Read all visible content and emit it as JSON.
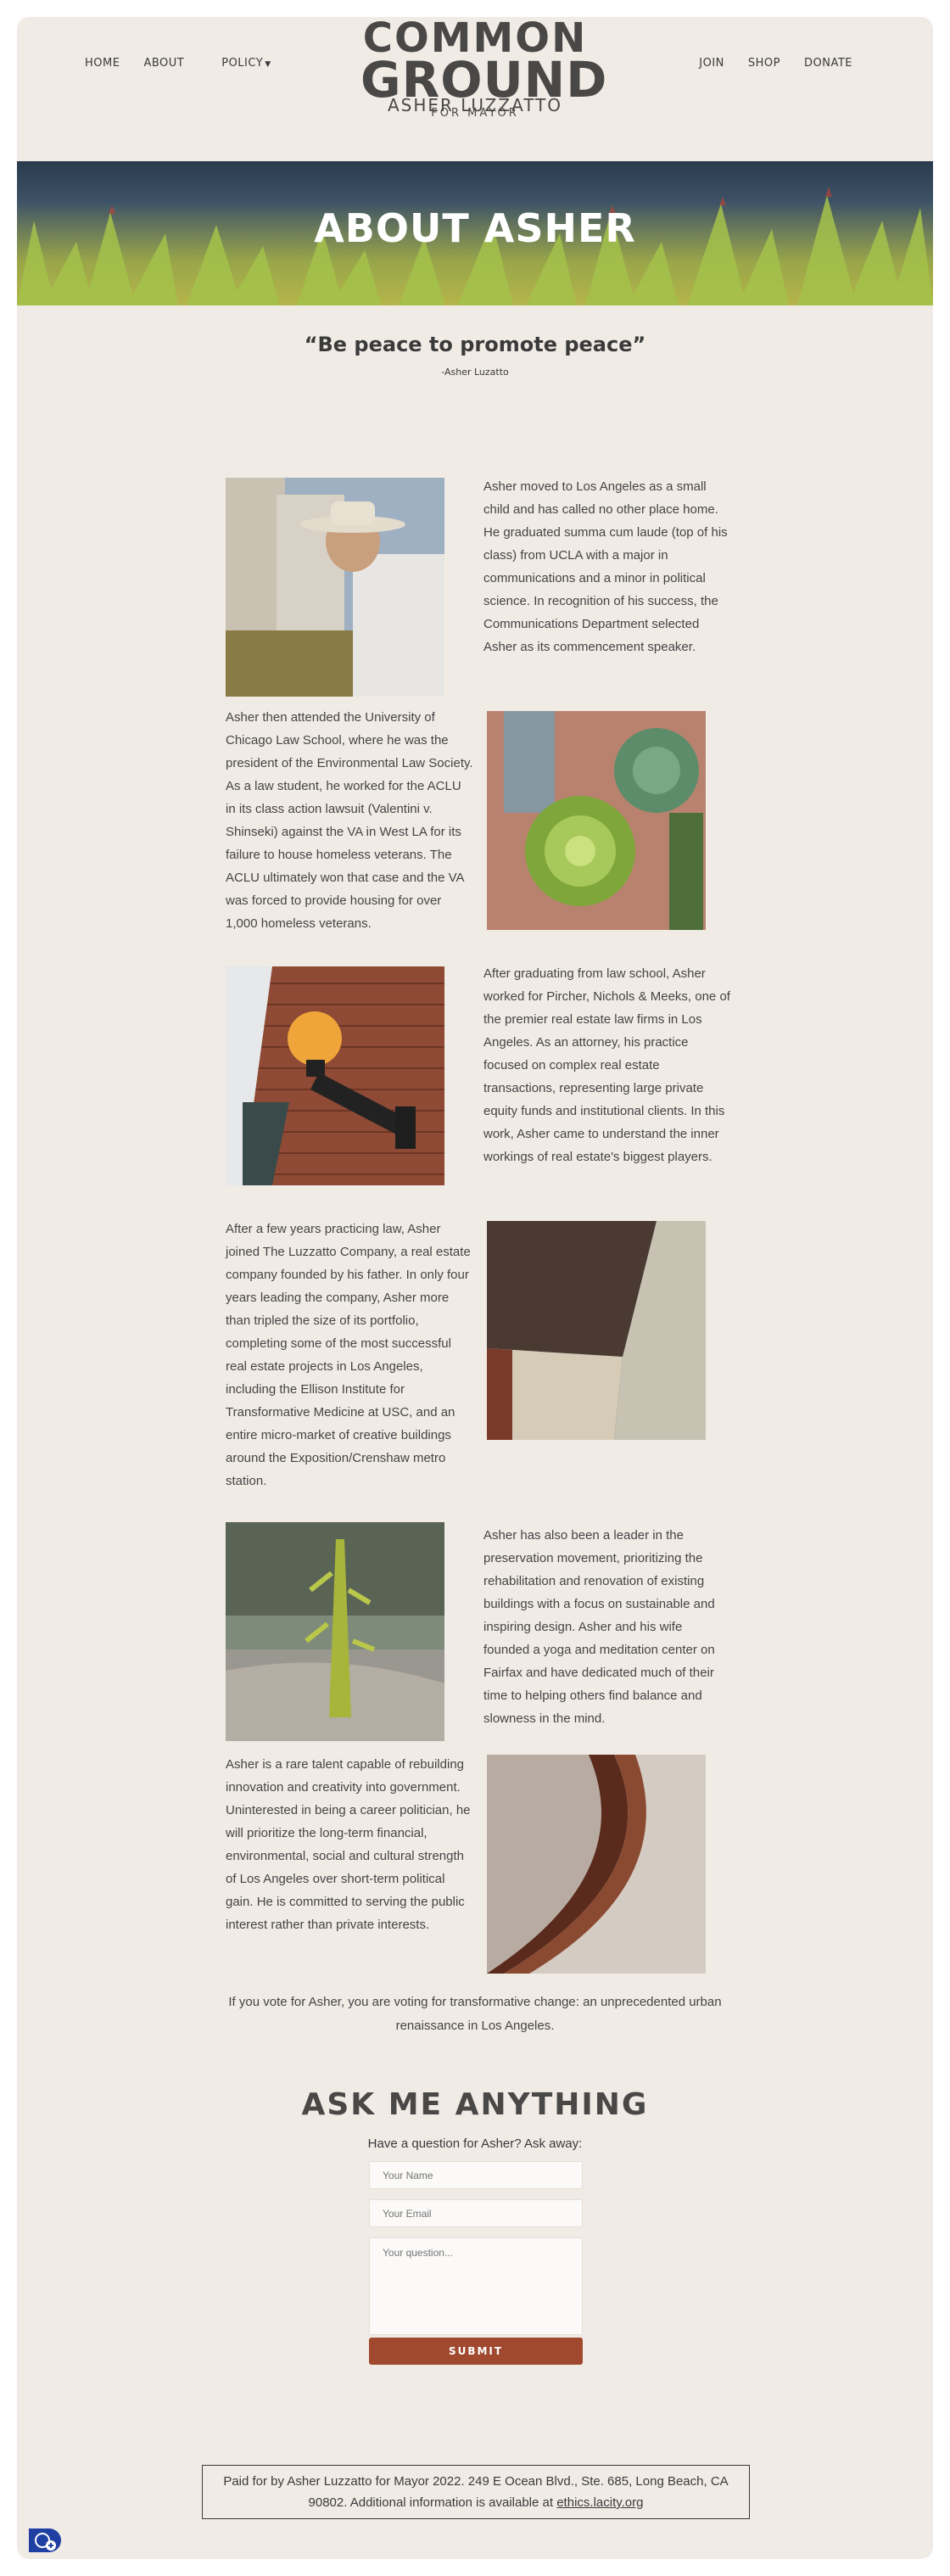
{
  "nav": {
    "home": "HOME",
    "about": "ABOUT",
    "policy": "POLICY",
    "join": "JOIN",
    "shop": "SHOP",
    "donate": "DONATE"
  },
  "logo": {
    "line1": "COMMON",
    "line2": "GROUND",
    "line3": "ASHER LUZZATTO",
    "line4": "FOR MAYOR"
  },
  "hero": {
    "title": "ABOUT ASHER"
  },
  "quote": {
    "text": "“Be peace to promote peace”",
    "attribution": "-Asher Luzatto"
  },
  "bio": [
    "Asher moved to Los Angeles as a small child and has called no other place home. He graduated summa cum laude (top of his class) from UCLA with a major in communications and a minor in political science. In recognition of his success, the Communications Department selected Asher as its commencement speaker.",
    "Asher then attended the University of Chicago Law School, where he was the president of the Environmental Law Society. As a law student, he worked for the ACLU in its class action lawsuit (Valentini v. Shinseki) against the VA in West LA for its failure to house homeless veterans. The ACLU ultimately won that case and the VA was forced to provide housing for over 1,000 homeless veterans.",
    "After graduating from law school, Asher worked for Pircher, Nichols & Meeks, one of the premier real estate law firms in Los Angeles. As an attorney, his practice focused on complex real estate transactions, representing large private equity funds and institutional clients. In this work, Asher came to understand the inner workings of real estate's biggest players.",
    "After a few years practicing law, Asher joined The Luzzatto Company, a real estate company founded by his father. In only four years leading the company, Asher more than tripled the size of its portfolio, completing some of the most successful real estate projects in Los Angeles, including the Ellison Institute for Transformative Medicine at USC, and an entire micro-market of creative buildings around the Exposition/Crenshaw metro station.",
    "Asher has also been a leader in the preservation movement, prioritizing the rehabilitation and renovation of existing buildings with a focus on sustainable and inspiring design. Asher and his wife founded a yoga and meditation center on Fairfax and have dedicated much of their time to helping others find balance and slowness in the mind.",
    "Asher is a rare talent capable of rebuilding innovation and creativity into government. Uninterested in being a career politician, he will prioritize the long-term financial, environmental, social and cultural strength of Los Angeles over short-term political gain. He is committed to serving the public interest rather than private interests."
  ],
  "closing": "If you vote for Asher, you are voting for transformative change: an unprecedented urban renaissance in Los Angeles.",
  "form": {
    "title": "ASK ME ANYTHING",
    "subtitle": "Have a question for Asher? Ask away:",
    "name_placeholder": "Your Name",
    "email_placeholder": "Your Email",
    "question_placeholder": "Your question...",
    "submit_label": "SUBMIT"
  },
  "footer": {
    "text": "Paid for by Asher Luzzatto for Mayor 2022. 249 E Ocean Blvd., Ste. 685, Long Beach, CA 90802. Additional information is available at",
    "link": "ethics.lacity.org"
  },
  "colors": {
    "background": "#f1ebe6",
    "text": "#3a3a3a",
    "accent": "#a0492f",
    "accessibility": "#1f3fa3"
  },
  "icons": [
    "caret-down-icon",
    "accessibility-icon"
  ]
}
